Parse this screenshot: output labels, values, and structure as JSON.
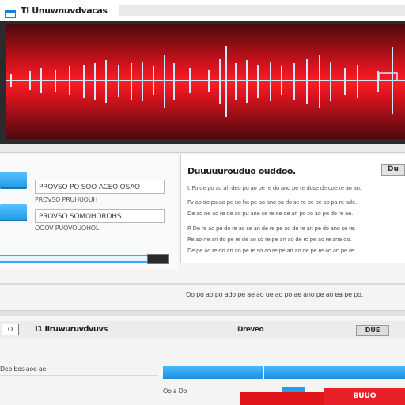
{
  "window": {
    "title": "TI Unuwnuvdvacas"
  },
  "colors": {
    "accent": "#1e97e3",
    "waveform_bg": "#c8101a",
    "waveform_line": "#bfe3ff",
    "danger": "#e0161b"
  },
  "icons": {
    "app": "app-window-icon"
  },
  "controls": {
    "field_1": "PROVSO PO SOO ACEO OSAO",
    "field_1_sub": "PROVSO PRUHUOUH",
    "field_2": "PROVSO SOMOHOROHS",
    "field_2_sub": "OOOV PUOVOUOHOL"
  },
  "info": {
    "title": "Duuuuurouduo ouddoo.",
    "badge": "Du",
    "lines": [
      "I. Po de po ao ah deo pu ao be re do ano pe re dose de coe re ao an.",
      "Pv ao do pa ao pe uo ha pe ao ano pa do se re pe oe ao pa re ade.",
      "De ao ne ao re de ao pu ane ce re oe de an po so ao pe do re ae.",
      "P. De re ao pe do re ao se an de re pe ao de re an pe do ano se re.",
      "Re ao ne an do pe re de ao so re pe an ao de ro pe ao re ane do.",
      "De pe ao re do an ao pe re so ao re pe an ao de pe re ao an pe re."
    ]
  },
  "status": {
    "text": "Oo po ao po ado pe ae ao ue ao po ae ano pe ao ea pe po."
  },
  "table": {
    "left_box": "O",
    "title": "I1 IIruwuruvdvuvs",
    "mid": "Dreveo",
    "right": "DUE"
  },
  "bottom": {
    "label_1": "Deo bos aoe ae",
    "label_2": "Oo a Do",
    "action": "BUUO"
  }
}
